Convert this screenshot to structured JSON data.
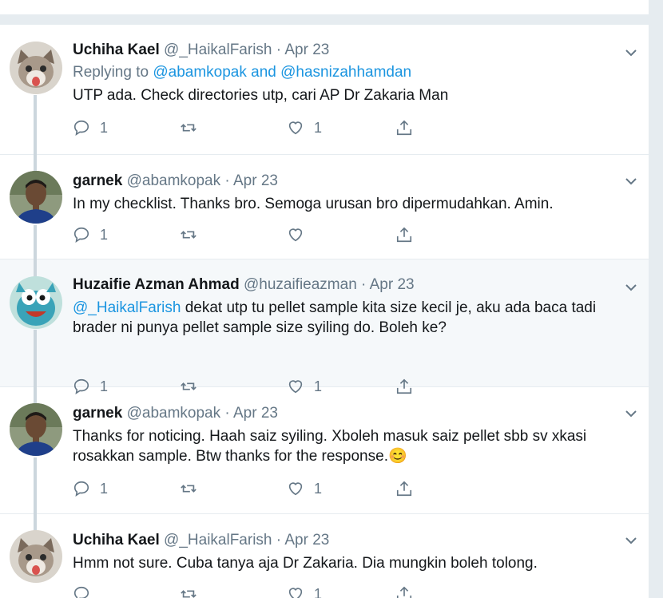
{
  "colors": {
    "link": "#1b95e0",
    "muted": "#657786",
    "text": "#14171a",
    "highlight_bg": "#f5f8fa",
    "thread_line": "#ccd6dd"
  },
  "tweets": [
    {
      "name": "Uchiha Kael",
      "handle": "@_HaikalFarish",
      "sep": " · ",
      "date": "Apr 23",
      "reply_prefix": "Replying to ",
      "reply_users": "@abamkopak and @hasnizahhamdan",
      "mention": "",
      "text": "UTP ada. Check directories utp, cari AP Dr Zakaria Man",
      "reply_count": "1",
      "retweet_count": "",
      "like_count": "1",
      "avatar": "kitten-avatar"
    },
    {
      "name": "garnek",
      "handle": "@abamkopak",
      "sep": " · ",
      "date": "Apr 23",
      "mention": "",
      "text": "In my checklist. Thanks bro. Semoga urusan bro dipermudahkan. Amin.",
      "reply_count": "1",
      "retweet_count": "",
      "like_count": "",
      "avatar": "man-avatar"
    },
    {
      "name": "Huzaifie Azman Ahmad",
      "handle": "@huzaifieazman",
      "sep": " · ",
      "date": "Apr 23",
      "mention": "@_HaikalFarish",
      "text": " dekat utp tu pellet sample kita size kecil je, aku ada baca tadi brader ni punya pellet sample size syiling do. Boleh ke?",
      "reply_count": "1",
      "retweet_count": "",
      "like_count": "1",
      "avatar": "cartoon-avatar"
    },
    {
      "name": "garnek",
      "handle": "@abamkopak",
      "sep": " · ",
      "date": "Apr 23",
      "mention": "",
      "text": "Thanks for noticing. Haah saiz syiling. Xboleh masuk saiz pellet sbb sv xkasi rosakkan sample. Btw thanks for the response.😊",
      "reply_count": "1",
      "retweet_count": "",
      "like_count": "1",
      "avatar": "man-avatar"
    },
    {
      "name": "Uchiha Kael",
      "handle": "@_HaikalFarish",
      "sep": " · ",
      "date": "Apr 23",
      "mention": "",
      "text": "Hmm not sure. Cuba tanya aja Dr Zakaria. Dia mungkin boleh tolong.",
      "reply_count": "",
      "retweet_count": "",
      "like_count": "1",
      "avatar": "kitten-avatar"
    }
  ]
}
